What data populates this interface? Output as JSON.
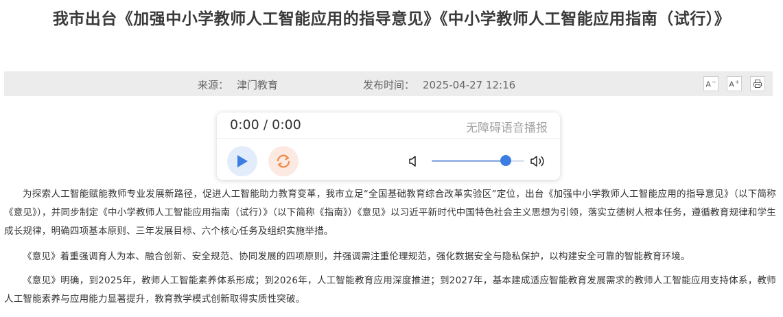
{
  "article": {
    "title": "我市出台《加强中小学教师人工智能应用的指导意见》《中小学教师人工智能应用指南（试行）》",
    "source_label": "来源：",
    "source_value": "津门教育",
    "date_label": "发布时间：",
    "date_value": "2025-04-27 12:16",
    "paragraphs": [
      "为探索人工智能赋能教师专业发展新路径，促进人工智能助力教育变革，我市立足“全国基础教育综合改革实验区”定位，出台《加强中小学教师人工智能应用的指导意见》（以下简称《意见》），并同步制定《中小学教师人工智能应用指南（试行）》（以下简称《指南》）《意见》以习近平新时代中国特色社会主义思想为引领，落实立德树人根本任务，遵循教育规律和学生成长规律，明确四项基本原则、三年发展目标、六个核心任务及组织实施举措。",
      "《意见》着重强调育人为本、融合创新、安全规范、协同发展的四项原则，并强调需注重伦理规范，强化数据安全与隐私保护，以构建安全可靠的智能教育环境。",
      "《意见》明确，到2025年，教师人工智能素养体系形成；到2026年，人工智能教育应用深度推进；到2027年，基本建成适应智能教育发展需求的教师人工智能应用支持体系，教师人工智能素养与应用能力显著提升，教育教学模式创新取得实质性突破。"
    ]
  },
  "toolbar": {
    "font_decrease": "A",
    "font_decrease_mark": "−",
    "font_increase": "A",
    "font_increase_mark": "+",
    "print_icon": "print-icon"
  },
  "player": {
    "time": "0:00 / 0:00",
    "label": "无障碍语音播报",
    "volume": 0.8,
    "colors": {
      "accent": "#3b7de0",
      "loop": "#f08a4b"
    }
  }
}
